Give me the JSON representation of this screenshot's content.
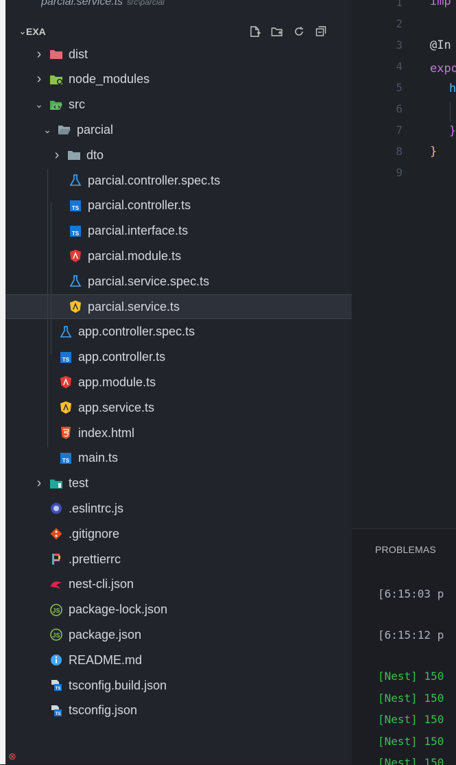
{
  "open_tab": {
    "name": "parcial.service.ts",
    "path": "src\\parcial"
  },
  "explorer": {
    "title": "EXA"
  },
  "tree": [
    {
      "label": "dist",
      "depth": 0,
      "chevron": "right",
      "icon": "folder-dist"
    },
    {
      "label": "node_modules",
      "depth": 0,
      "chevron": "right",
      "icon": "folder-node"
    },
    {
      "label": "src",
      "depth": 0,
      "chevron": "down",
      "icon": "folder-src-open"
    },
    {
      "label": "parcial",
      "depth": 1,
      "chevron": "down",
      "icon": "folder-open"
    },
    {
      "label": "dto",
      "depth": 2,
      "chevron": "right",
      "icon": "folder"
    },
    {
      "label": "parcial.controller.spec.ts",
      "depth": 3,
      "icon": "test-flask"
    },
    {
      "label": "parcial.controller.ts",
      "depth": 3,
      "icon": "typescript"
    },
    {
      "label": "parcial.interface.ts",
      "depth": 3,
      "icon": "typescript"
    },
    {
      "label": "parcial.module.ts",
      "depth": 3,
      "icon": "angular-red"
    },
    {
      "label": "parcial.service.spec.ts",
      "depth": 3,
      "icon": "test-flask"
    },
    {
      "label": "parcial.service.ts",
      "depth": 3,
      "icon": "angular-yellow",
      "selected": true
    },
    {
      "label": "app.controller.spec.ts",
      "depth": 2,
      "icon": "test-flask"
    },
    {
      "label": "app.controller.ts",
      "depth": 2,
      "icon": "typescript"
    },
    {
      "label": "app.module.ts",
      "depth": 2,
      "icon": "angular-red"
    },
    {
      "label": "app.service.ts",
      "depth": 2,
      "icon": "angular-yellow"
    },
    {
      "label": "index.html",
      "depth": 2,
      "icon": "html"
    },
    {
      "label": "main.ts",
      "depth": 2,
      "icon": "typescript"
    },
    {
      "label": "test",
      "depth": 0,
      "chevron": "right",
      "icon": "folder-test"
    },
    {
      "label": ".eslintrc.js",
      "depth": 1,
      "icon": "eslint"
    },
    {
      "label": ".gitignore",
      "depth": 1,
      "icon": "git"
    },
    {
      "label": ".prettierrc",
      "depth": 1,
      "icon": "prettier"
    },
    {
      "label": "nest-cli.json",
      "depth": 1,
      "icon": "nest"
    },
    {
      "label": "package-lock.json",
      "depth": 1,
      "icon": "nodejs"
    },
    {
      "label": "package.json",
      "depth": 1,
      "icon": "nodejs"
    },
    {
      "label": "README.md",
      "depth": 1,
      "icon": "info"
    },
    {
      "label": "tsconfig.build.json",
      "depth": 1,
      "icon": "tsconfig"
    },
    {
      "label": "tsconfig.json",
      "depth": 1,
      "icon": "tsconfig"
    }
  ],
  "editor": {
    "line_numbers": [
      "1",
      "2",
      "3",
      "4",
      "5",
      "6",
      "7",
      "8",
      "9"
    ],
    "code": [
      "imp",
      "@In",
      "expo",
      "h",
      "}",
      "}"
    ]
  },
  "panel": {
    "tab": "PROBLEMAS",
    "lines": [
      "[6:15:03 p",
      "[6:15:12 p",
      "[Nest] 150",
      "[Nest] 150",
      "[Nest] 150",
      "[Nest] 150",
      "[Nest] 150"
    ]
  },
  "colors": {
    "accent_green": "#3fbf4f",
    "selection": "#2c313a",
    "sidebar_bg": "#21252b"
  }
}
